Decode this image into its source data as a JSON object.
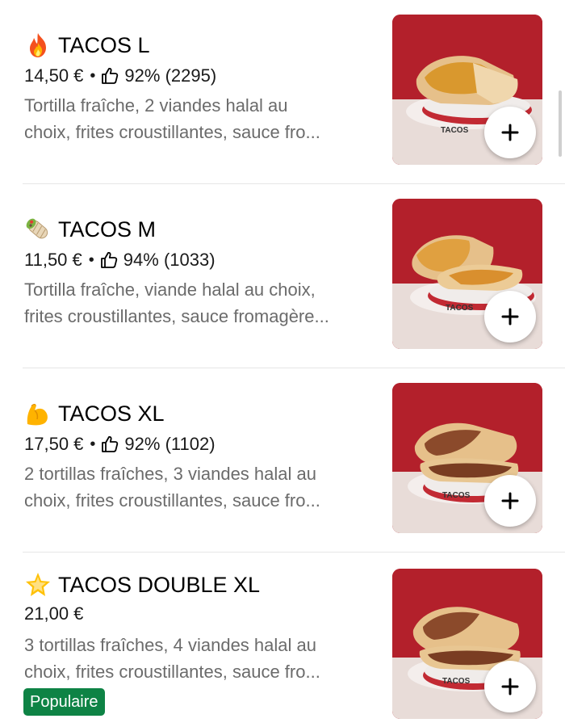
{
  "menu": {
    "items": [
      {
        "emoji": "fire-icon",
        "name": "TACOS L",
        "price": "14,50 €",
        "rating": "92% (2295)",
        "description_line1": "Tortilla fraîche, 2 viandes halal au",
        "description_line2": "choix, frites croustillantes, sauce fro...",
        "image_label": "TACOS"
      },
      {
        "emoji": "burrito-icon",
        "name": "TACOS M",
        "price": "11,50 €",
        "rating": "94% (1033)",
        "description_line1": "Tortilla fraîche, viande halal au choix,",
        "description_line2": "frites croustillantes, sauce fromagère...",
        "image_label": "TACOS"
      },
      {
        "emoji": "flexed-biceps-icon",
        "name": "TACOS XL",
        "price": "17,50 €",
        "rating": "92% (1102)",
        "description_line1": "2 tortillas fraîches, 3 viandes halal au",
        "description_line2": "choix, frites croustillantes, sauce fro...",
        "image_label": "TACOS"
      },
      {
        "emoji": "glowing-star-icon",
        "name": "TACOS DOUBLE XL",
        "price": "21,00 €",
        "rating": "",
        "description_line1": "3 tortillas fraîches, 4 viandes halal au",
        "description_line2": "choix, frites croustillantes, sauce fro...",
        "badge": "Populaire",
        "image_label": "TACOS"
      }
    ],
    "meta_separator": "•"
  },
  "colors": {
    "badge_green": "#0e8345",
    "image_red": "#b3202b",
    "description_gray": "#6b6b6b"
  }
}
